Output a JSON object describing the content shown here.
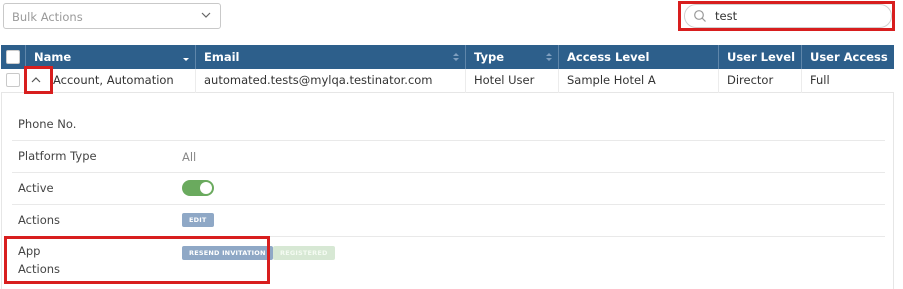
{
  "toolbar": {
    "bulk_actions_label": "Bulk Actions",
    "search_value": "test"
  },
  "table": {
    "headers": [
      "Name",
      "Email",
      "Type",
      "Access Level",
      "User Level",
      "User Access"
    ],
    "row": {
      "name": "Account, Automation",
      "email": "automated.tests@mylqa.testinator.com",
      "type": "Hotel User",
      "access_level": "Sample Hotel A",
      "user_level": "Director",
      "user_access": "Full"
    }
  },
  "details": {
    "phone_label": "Phone No.",
    "platform_label": "Platform Type",
    "platform_value": "All",
    "active_label": "Active",
    "active_on": true,
    "actions_label": "Actions",
    "edit_button": "EDIT",
    "app_actions_label_1": "App",
    "app_actions_label_2": "Actions",
    "resend_button": "RESEND INVITATION",
    "registered_button": "REGISTERED"
  },
  "colors": {
    "header_bg": "#2d5f8b",
    "highlight": "#d81e1e",
    "toggle_on": "#6aaa5e",
    "button_blue": "#8fa8c6"
  }
}
